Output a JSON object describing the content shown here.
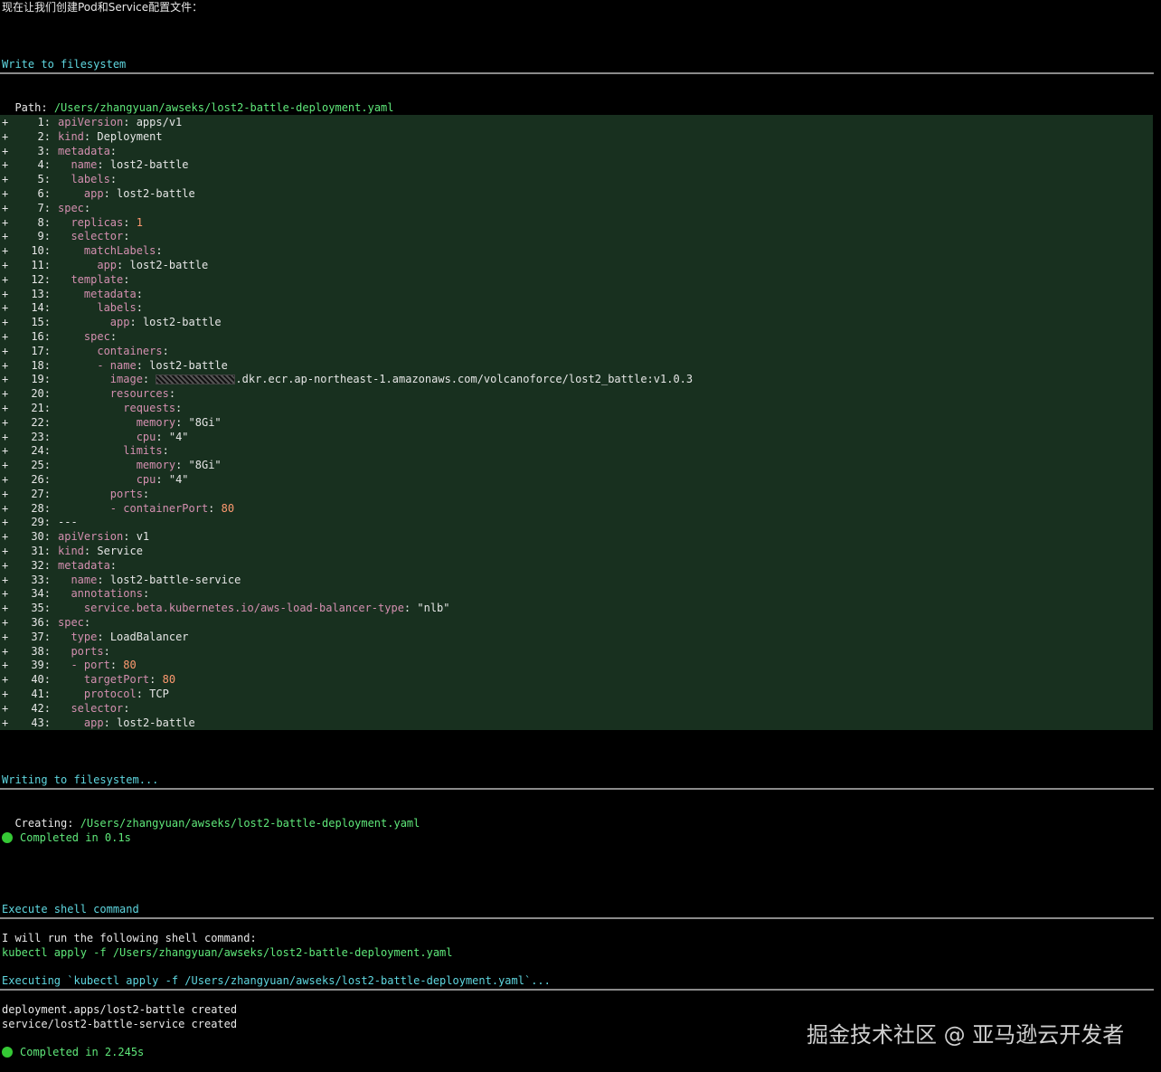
{
  "intro": "现在让我们创建Pod和Service配置文件：",
  "write": {
    "heading": "Write to filesystem",
    "path_label": "Path: ",
    "path": "/Users/zhangyuan/awseks/lost2-battle-deployment.yaml"
  },
  "diff": {
    "prefix": "+",
    "lines": [
      {
        "n": "1:",
        "indent": "",
        "key": "apiVersion",
        "val": " apps/v1"
      },
      {
        "n": "2:",
        "indent": "",
        "key": "kind",
        "val": " Deployment"
      },
      {
        "n": "3:",
        "indent": "",
        "key": "metadata",
        "val": ""
      },
      {
        "n": "4:",
        "indent": "  ",
        "key": "name",
        "val": " lost2-battle"
      },
      {
        "n": "5:",
        "indent": "  ",
        "key": "labels",
        "val": ""
      },
      {
        "n": "6:",
        "indent": "    ",
        "key": "app",
        "val": " lost2-battle"
      },
      {
        "n": "7:",
        "indent": "",
        "key": "spec",
        "val": ""
      },
      {
        "n": "8:",
        "indent": "  ",
        "key": "replicas",
        "val": " 1",
        "num": true
      },
      {
        "n": "9:",
        "indent": "  ",
        "key": "selector",
        "val": ""
      },
      {
        "n": "10:",
        "indent": "    ",
        "key": "matchLabels",
        "val": ""
      },
      {
        "n": "11:",
        "indent": "      ",
        "key": "app",
        "val": " lost2-battle"
      },
      {
        "n": "12:",
        "indent": "  ",
        "key": "template",
        "val": ""
      },
      {
        "n": "13:",
        "indent": "    ",
        "key": "metadata",
        "val": ""
      },
      {
        "n": "14:",
        "indent": "      ",
        "key": "labels",
        "val": ""
      },
      {
        "n": "15:",
        "indent": "        ",
        "key": "app",
        "val": " lost2-battle"
      },
      {
        "n": "16:",
        "indent": "    ",
        "key": "spec",
        "val": ""
      },
      {
        "n": "17:",
        "indent": "      ",
        "key": "containers",
        "val": ""
      },
      {
        "n": "18:",
        "indent": "      - ",
        "key": "name",
        "val": " lost2-battle"
      },
      {
        "n": "19:",
        "indent": "        ",
        "key": "image",
        "val": ".dkr.ecr.ap-northeast-1.amazonaws.com/volcanoforce/lost2_battle:v1.0.3",
        "redacted": true
      },
      {
        "n": "20:",
        "indent": "        ",
        "key": "resources",
        "val": ""
      },
      {
        "n": "21:",
        "indent": "          ",
        "key": "requests",
        "val": ""
      },
      {
        "n": "22:",
        "indent": "            ",
        "key": "memory",
        "val": " \"8Gi\""
      },
      {
        "n": "23:",
        "indent": "            ",
        "key": "cpu",
        "val": " \"4\""
      },
      {
        "n": "24:",
        "indent": "          ",
        "key": "limits",
        "val": ""
      },
      {
        "n": "25:",
        "indent": "            ",
        "key": "memory",
        "val": " \"8Gi\""
      },
      {
        "n": "26:",
        "indent": "            ",
        "key": "cpu",
        "val": " \"4\""
      },
      {
        "n": "27:",
        "indent": "        ",
        "key": "ports",
        "val": ""
      },
      {
        "n": "28:",
        "indent": "        - ",
        "key": "containerPort",
        "val": " 80",
        "num": true
      },
      {
        "n": "29:",
        "indent": "",
        "key": "",
        "val": "---",
        "plain": true
      },
      {
        "n": "30:",
        "indent": "",
        "key": "apiVersion",
        "val": " v1"
      },
      {
        "n": "31:",
        "indent": "",
        "key": "kind",
        "val": " Service"
      },
      {
        "n": "32:",
        "indent": "",
        "key": "metadata",
        "val": ""
      },
      {
        "n": "33:",
        "indent": "  ",
        "key": "name",
        "val": " lost2-battle-service"
      },
      {
        "n": "34:",
        "indent": "  ",
        "key": "annotations",
        "val": ""
      },
      {
        "n": "35:",
        "indent": "    ",
        "key": "service.beta.kubernetes.io/aws-load-balancer-type",
        "val": " \"nlb\""
      },
      {
        "n": "36:",
        "indent": "",
        "key": "spec",
        "val": ""
      },
      {
        "n": "37:",
        "indent": "  ",
        "key": "type",
        "val": " LoadBalancer"
      },
      {
        "n": "38:",
        "indent": "  ",
        "key": "ports",
        "val": ""
      },
      {
        "n": "39:",
        "indent": "  - ",
        "key": "port",
        "val": " 80",
        "num": true
      },
      {
        "n": "40:",
        "indent": "    ",
        "key": "targetPort",
        "val": " 80",
        "num": true
      },
      {
        "n": "41:",
        "indent": "    ",
        "key": "protocol",
        "val": " TCP"
      },
      {
        "n": "42:",
        "indent": "  ",
        "key": "selector",
        "val": ""
      },
      {
        "n": "43:",
        "indent": "    ",
        "key": "app",
        "val": " lost2-battle"
      }
    ]
  },
  "writing": {
    "heading": "Writing to filesystem...",
    "creating_label": "Creating: ",
    "creating_path": "/Users/zhangyuan/awseks/lost2-battle-deployment.yaml",
    "completed": "Completed in 0.1s"
  },
  "shell": {
    "heading": "Execute shell command",
    "intro": "I will run the following shell command:",
    "command": "kubectl apply -f /Users/zhangyuan/awseks/lost2-battle-deployment.yaml",
    "executing": "Executing `kubectl apply -f /Users/zhangyuan/awseks/lost2-battle-deployment.yaml`...",
    "output1": "deployment.apps/lost2-battle created",
    "output2": "service/lost2-battle-service created",
    "completed": "Completed in 2.245s"
  },
  "watermark": "掘金技术社区 @ 亚马逊云开发者",
  "colors": {
    "background": "#000000",
    "heading": "#5fd7e0",
    "path": "#5fe87a",
    "diff_bg": "#18301f",
    "yaml_key": "#d48fb0",
    "yaml_number": "#ff9a70",
    "status_dot": "#35c935"
  }
}
